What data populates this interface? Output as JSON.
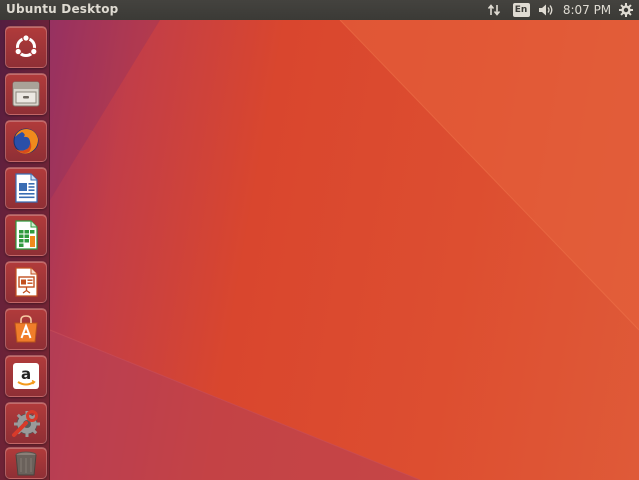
{
  "top_panel": {
    "title": "Ubuntu Desktop",
    "keyboard_layout": "En",
    "clock": "8:07 PM",
    "icons": [
      "network-transfer-icon",
      "keyboard-layout-icon",
      "volume-icon",
      "session-gear-icon"
    ]
  },
  "launcher": {
    "items": [
      {
        "name": "dash-home",
        "icon": "ubuntu-logo-icon"
      },
      {
        "name": "files",
        "icon": "file-cabinet-icon"
      },
      {
        "name": "firefox",
        "icon": "firefox-icon"
      },
      {
        "name": "libreoffice-writer",
        "icon": "writer-document-icon"
      },
      {
        "name": "libreoffice-calc",
        "icon": "calc-spreadsheet-icon"
      },
      {
        "name": "libreoffice-impress",
        "icon": "impress-presentation-icon"
      },
      {
        "name": "ubuntu-software",
        "icon": "shopping-bag-icon"
      },
      {
        "name": "amazon",
        "icon": "amazon-logo-icon"
      },
      {
        "name": "system-settings",
        "icon": "settings-wrench-gear-icon"
      },
      {
        "name": "trash",
        "icon": "trash-icon"
      }
    ]
  },
  "colors": {
    "panel_bg": "#3c3b37",
    "panel_text": "#dfdbd2",
    "wallpaper_accent": "#dd4e30",
    "wallpaper_purple": "#6e2a70"
  }
}
